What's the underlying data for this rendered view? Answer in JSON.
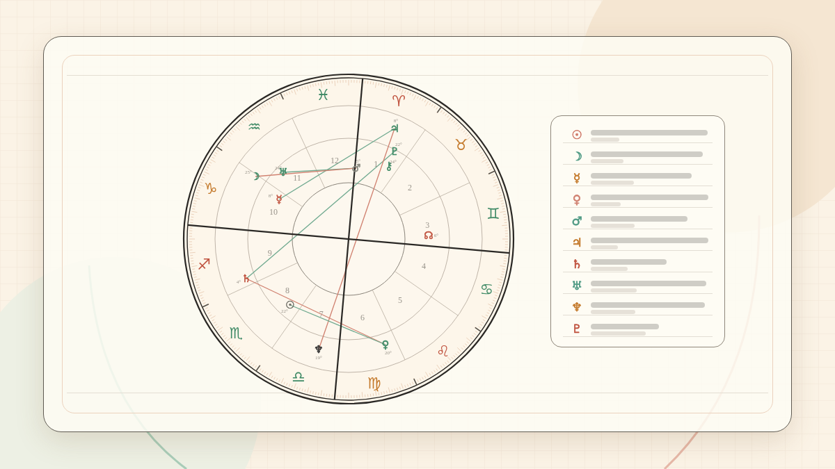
{
  "signs": [
    {
      "glyph": "♈",
      "color": "#c0533f"
    },
    {
      "glyph": "♉",
      "color": "#c47a2c"
    },
    {
      "glyph": "♊",
      "color": "#3f8a66"
    },
    {
      "glyph": "♋",
      "color": "#3f8a66"
    },
    {
      "glyph": "♌",
      "color": "#c0533f"
    },
    {
      "glyph": "♍",
      "color": "#c47a2c"
    },
    {
      "glyph": "♎",
      "color": "#3f8a66"
    },
    {
      "glyph": "♏",
      "color": "#3f8a66"
    },
    {
      "glyph": "♐",
      "color": "#c0533f"
    },
    {
      "glyph": "♑",
      "color": "#c47a2c"
    },
    {
      "glyph": "♒",
      "color": "#3f8a66"
    },
    {
      "glyph": "♓",
      "color": "#3f8a66"
    }
  ],
  "houses": [
    "1",
    "2",
    "3",
    "4",
    "5",
    "6",
    "7",
    "8",
    "9",
    "10",
    "11",
    "12"
  ],
  "planets": [
    {
      "glyph": "♃",
      "degree": "8°",
      "color": "#3f8a66"
    },
    {
      "glyph": "♇",
      "degree": "22°",
      "color": "#3f8a66"
    },
    {
      "glyph": "☽",
      "degree": "25°",
      "color": "#3f8a66"
    },
    {
      "glyph": "♅",
      "degree": "24°",
      "color": "#3f8a66"
    },
    {
      "glyph": "♂",
      "degree": "5°",
      "color": "#8a8a80"
    },
    {
      "glyph": "⚷",
      "degree": "24°",
      "color": "#3f8a66"
    },
    {
      "glyph": "☿",
      "degree": "8°",
      "color": "#c0533f"
    },
    {
      "glyph": "☊",
      "degree": "6°",
      "color": "#c0533f"
    },
    {
      "glyph": "♄",
      "degree": "4°",
      "color": "#c0533f"
    },
    {
      "glyph": "☉",
      "degree": "22°",
      "color": "#707068"
    },
    {
      "glyph": "♆",
      "degree": "19°",
      "color": "#333333"
    },
    {
      "glyph": "♀",
      "degree": "20°",
      "color": "#3f8a66"
    }
  ],
  "legend": [
    {
      "glyph": "☉",
      "color": "#d07a6a"
    },
    {
      "glyph": "☽",
      "color": "#4f9a84"
    },
    {
      "glyph": "☿",
      "color": "#c47a2c"
    },
    {
      "glyph": "♀",
      "color": "#d08070"
    },
    {
      "glyph": "♂",
      "color": "#4f9a84"
    },
    {
      "glyph": "♃",
      "color": "#c47a2c"
    },
    {
      "glyph": "♄",
      "color": "#c0533f"
    },
    {
      "glyph": "♅",
      "color": "#4f9a84"
    },
    {
      "glyph": "♆",
      "color": "#c47a2c"
    },
    {
      "glyph": "♇",
      "color": "#c0533f"
    }
  ]
}
